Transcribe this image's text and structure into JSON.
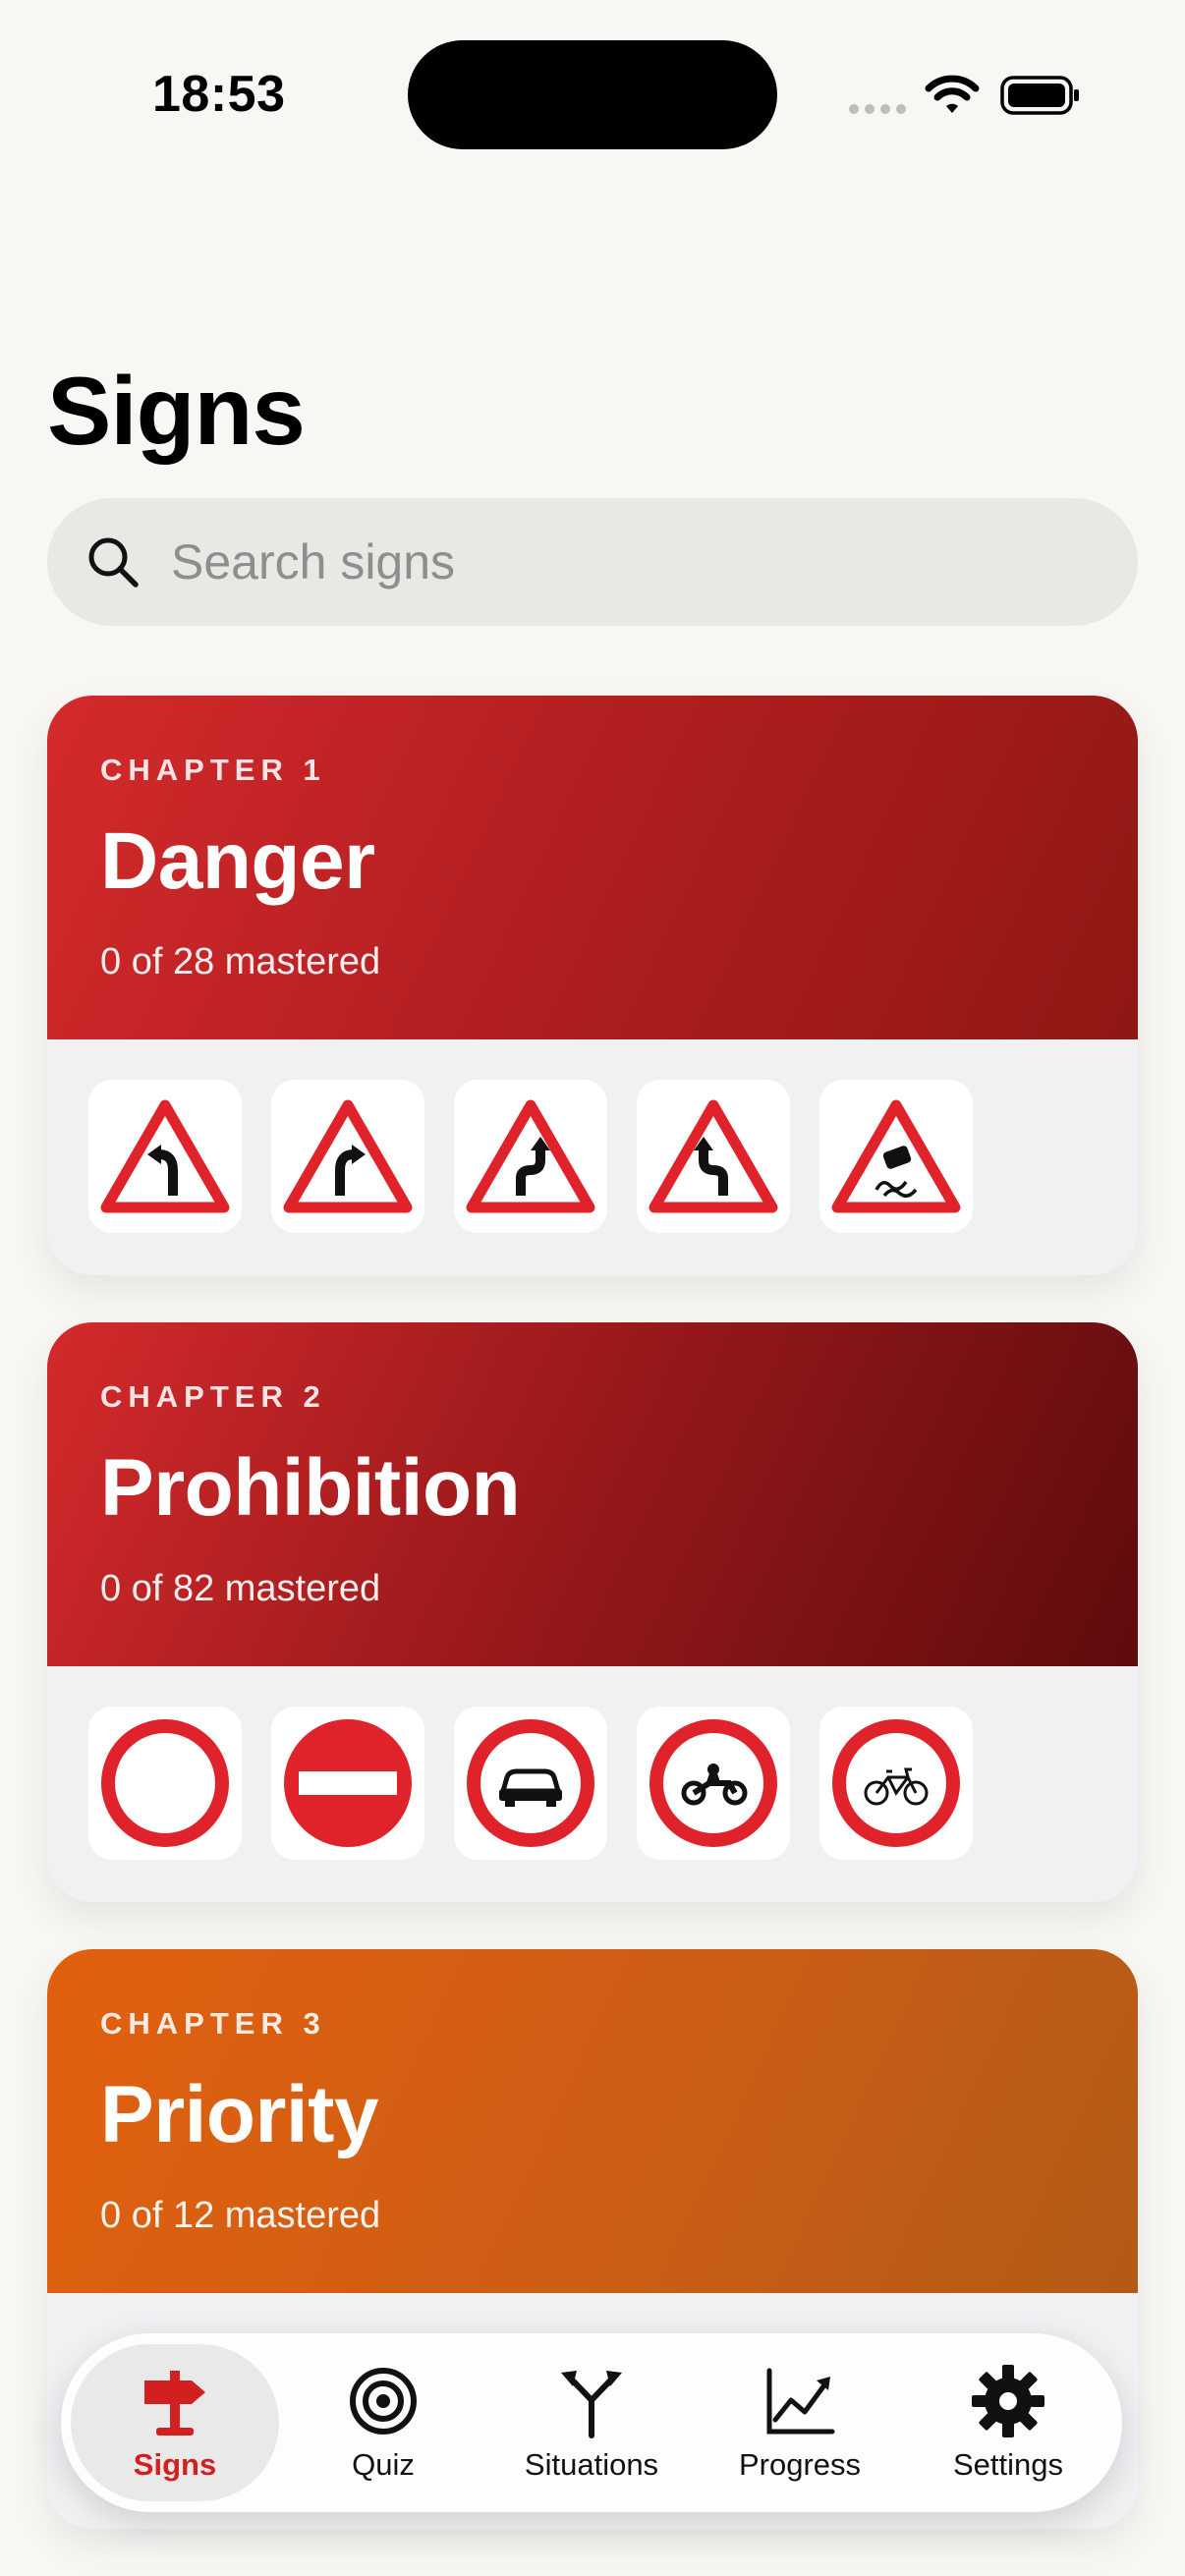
{
  "status_bar": {
    "time": "18:53"
  },
  "page": {
    "title": "Signs"
  },
  "search": {
    "placeholder": "Search signs",
    "value": ""
  },
  "chapters": [
    {
      "label": "CHAPTER 1",
      "title": "Danger",
      "progress": "0 of 28 mastered",
      "thumbs": [
        "sharp-left-bend-sign",
        "sharp-right-bend-sign",
        "double-bend-left-sign",
        "double-bend-right-sign",
        "slippery-road-sign"
      ]
    },
    {
      "label": "CHAPTER 2",
      "title": "Prohibition",
      "progress": "0 of 82 mastered",
      "thumbs": [
        "no-vehicles-sign",
        "no-entry-sign",
        "no-cars-sign",
        "no-motorcycles-sign",
        "no-bicycles-sign"
      ]
    },
    {
      "label": "CHAPTER 3",
      "title": "Priority",
      "progress": "0 of 12 mastered"
    }
  ],
  "tabs": [
    {
      "label": "Signs",
      "icon": "signpost-icon",
      "active": true
    },
    {
      "label": "Quiz",
      "icon": "target-icon"
    },
    {
      "label": "Situations",
      "icon": "fork-icon"
    },
    {
      "label": "Progress",
      "icon": "chart-icon"
    },
    {
      "label": "Settings",
      "icon": "gear-icon"
    }
  ],
  "colors": {
    "accent": "#d21f1f",
    "danger": "#d42a2c",
    "prohibition": "#96181a",
    "priority": "#e2600f",
    "sign_red": "#e0232a"
  }
}
